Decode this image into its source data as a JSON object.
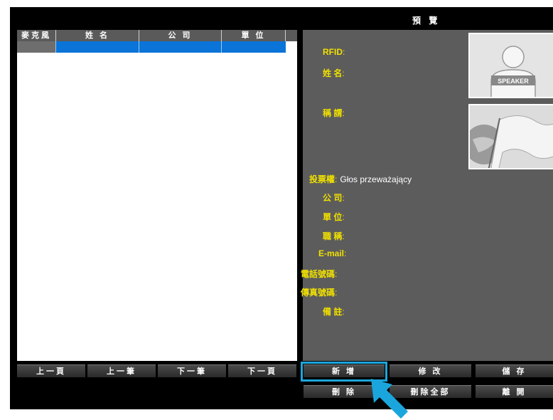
{
  "window": {
    "title": "預 覽"
  },
  "table": {
    "columns": [
      "麥克風",
      "姓 名",
      "公 司",
      "單 位"
    ]
  },
  "preview": {
    "fields": [
      {
        "label": "RFID",
        "value": ""
      },
      {
        "label": "姓 名",
        "value": ""
      },
      {
        "label": "稱 謂",
        "value": ""
      },
      {
        "label": "投票權",
        "value": "Głos przeważający"
      },
      {
        "label": "公 司",
        "value": ""
      },
      {
        "label": "單 位",
        "value": ""
      },
      {
        "label": "職 稱",
        "value": ""
      },
      {
        "label": "E-mail",
        "value": ""
      },
      {
        "label": "電話號碼",
        "value": ""
      },
      {
        "label": "傳真號碼",
        "value": ""
      },
      {
        "label": "備 註",
        "value": ""
      }
    ],
    "photo_text": "SPEAKER"
  },
  "nav": {
    "prev_page": "上一頁",
    "prev_record": "上一筆",
    "next_record": "下一筆",
    "next_page": "下一頁"
  },
  "actions": {
    "add": "新 增",
    "edit": "修 改",
    "save": "儲 存",
    "delete": "刪 除",
    "delete_all": "刪除全部",
    "leave": "離 開"
  },
  "colors": {
    "accent": "#1aa6dc",
    "label": "#f0e000",
    "selection": "#0a74d8"
  }
}
